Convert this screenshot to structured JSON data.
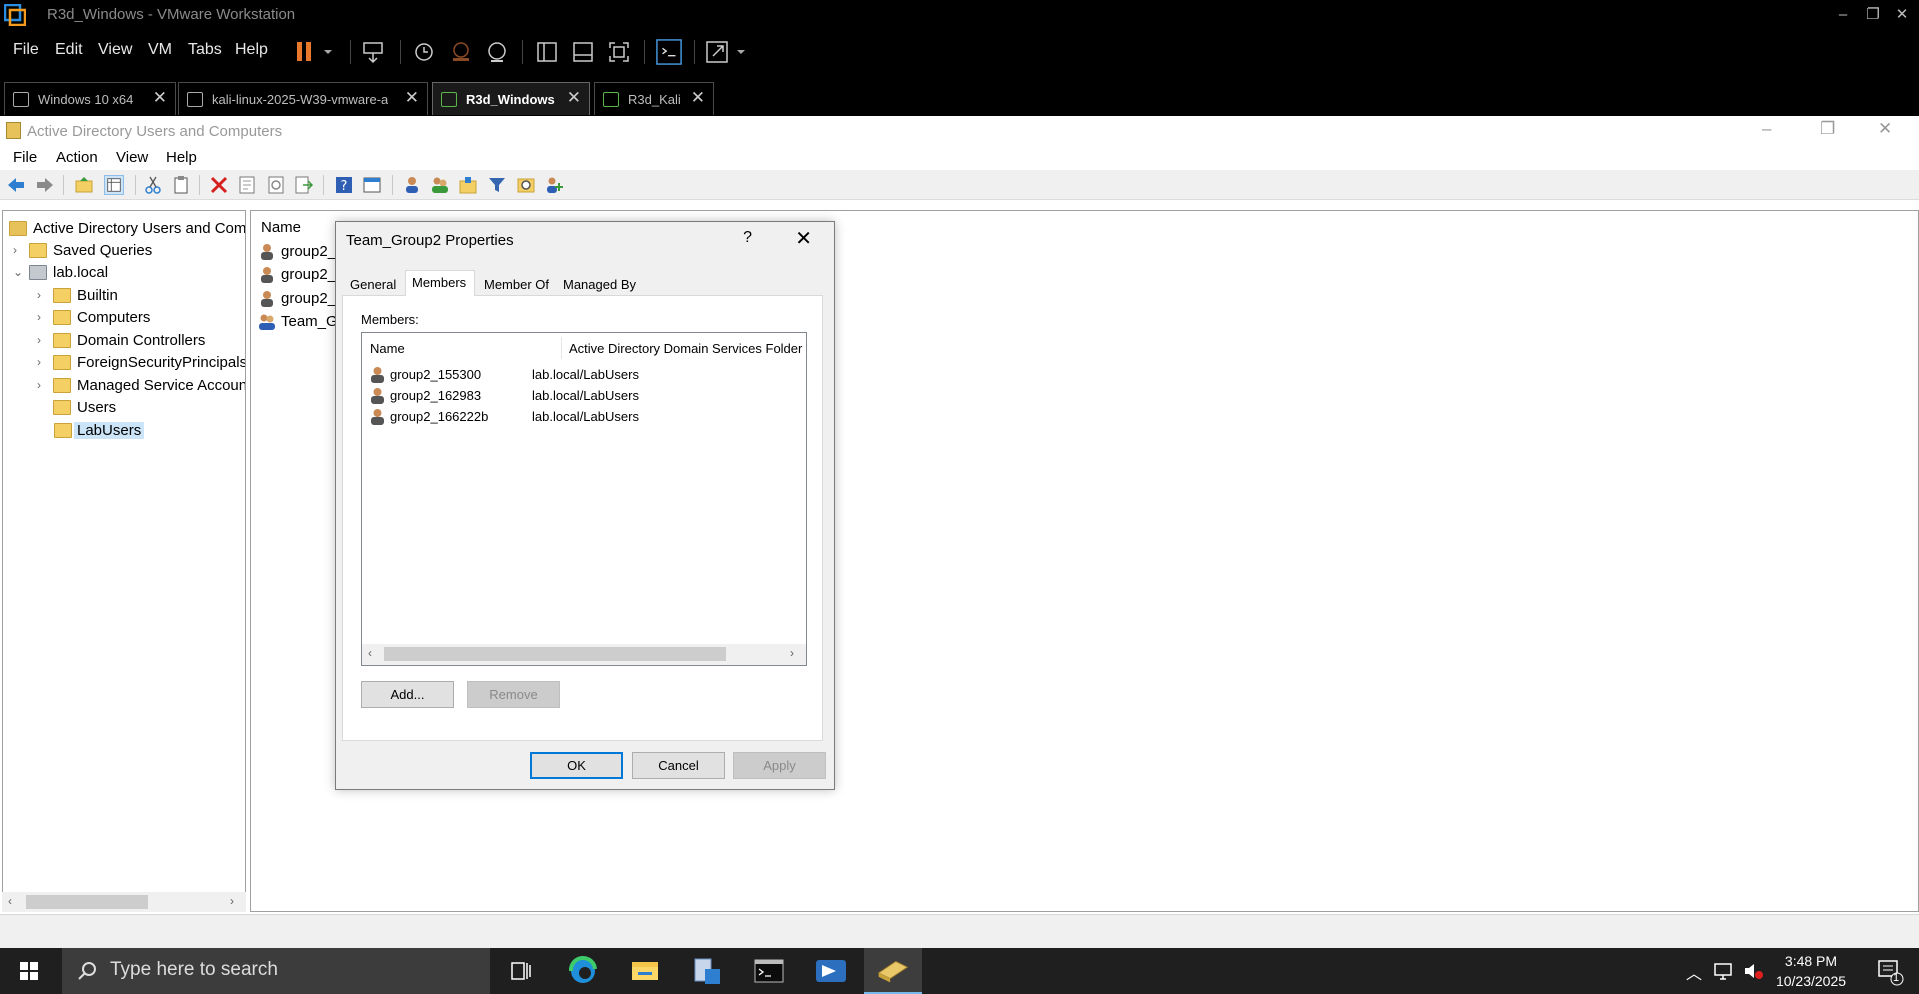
{
  "vmware": {
    "window_title": "R3d_Windows - VMware Workstation",
    "menu": [
      "File",
      "Edit",
      "View",
      "VM",
      "Tabs",
      "Help"
    ],
    "tabs": [
      {
        "label": "Windows 10 x64",
        "active": false
      },
      {
        "label": "kali-linux-2025-W39-vmware-a...",
        "active": false
      },
      {
        "label": "R3d_Windows",
        "active": true
      },
      {
        "label": "R3d_Kali",
        "active": false
      }
    ],
    "accent_pause_color": "#e8782b"
  },
  "ad_window": {
    "title": "Active Directory Users and Computers",
    "menu": [
      "File",
      "Action",
      "View",
      "Help"
    ]
  },
  "tree": {
    "root": "Active Directory Users and Comp",
    "saved_queries": "Saved Queries",
    "domain": "lab.local",
    "children": [
      "Builtin",
      "Computers",
      "Domain Controllers",
      "ForeignSecurityPrincipals",
      "Managed Service Accoun",
      "Users",
      "LabUsers"
    ],
    "selected": "LabUsers"
  },
  "list": {
    "column_name": "Name",
    "rows": [
      "group2_",
      "group2_",
      "group2_",
      "Team_Gr"
    ]
  },
  "dialog": {
    "title": "Team_Group2 Properties",
    "help": "?",
    "close": "✕",
    "tabs": [
      "General",
      "Members",
      "Member Of",
      "Managed By"
    ],
    "active_tab": "Members",
    "members_label": "Members:",
    "columns": [
      "Name",
      "Active Directory Domain Services Folder"
    ],
    "members": [
      {
        "name": "group2_155300",
        "folder": "lab.local/LabUsers"
      },
      {
        "name": "group2_162983",
        "folder": "lab.local/LabUsers"
      },
      {
        "name": "group2_166222b",
        "folder": "lab.local/LabUsers"
      }
    ],
    "add_button": "Add...",
    "remove_button": "Remove",
    "ok_button": "OK",
    "cancel_button": "Cancel",
    "apply_button": "Apply"
  },
  "taskbar": {
    "search_placeholder": "Type here to search",
    "time": "3:48 PM",
    "date": "10/23/2025",
    "notification_count": "1"
  }
}
